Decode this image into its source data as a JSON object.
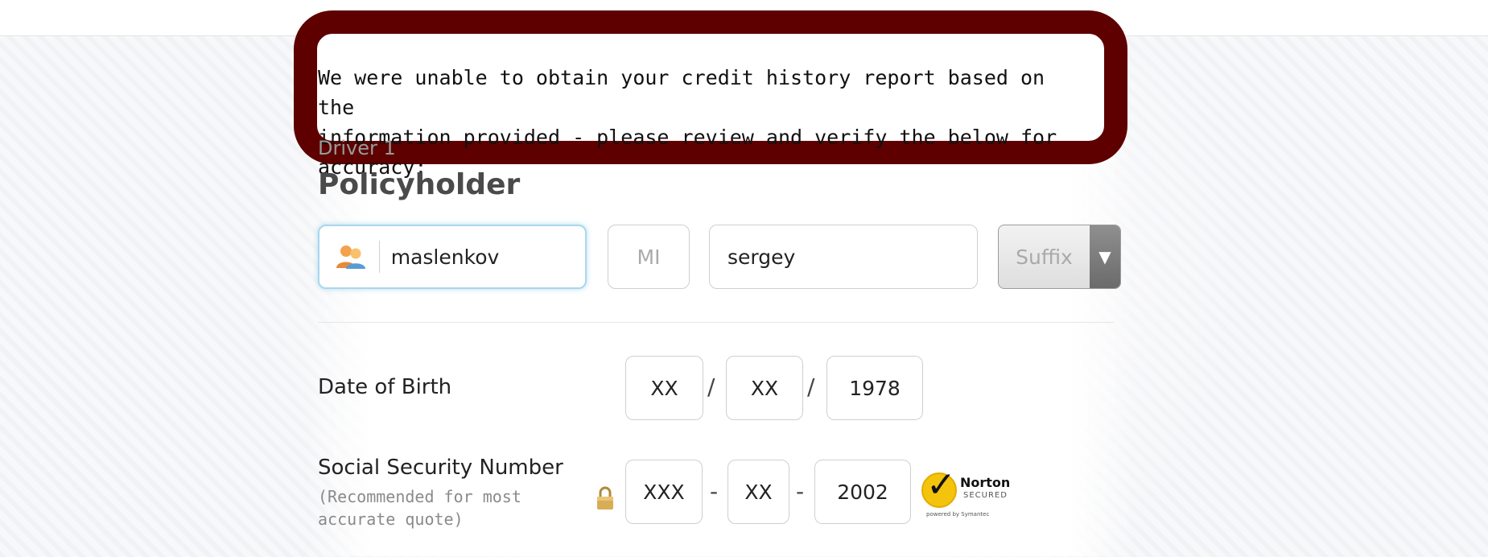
{
  "alert": {
    "message_line1": "We were unable to obtain your credit history report based on the",
    "message_line2": "information provided - please review and verify the below for accuracy:"
  },
  "driver": {
    "label": "Driver 1",
    "section_title": "Policyholder"
  },
  "name_fields": {
    "last_name_value": "maslenkov",
    "middle_initial_placeholder": "MI",
    "first_name_value": "sergey",
    "suffix_label": "Suffix"
  },
  "date_of_birth": {
    "label": "Date of Birth",
    "month": "XX",
    "day": "XX",
    "year": "1978",
    "separator": "/"
  },
  "ssn": {
    "label": "Social Security Number",
    "note": "(Recommended for most accurate quote)",
    "part1": "XXX",
    "part2": "XX",
    "part3": "2002",
    "separator": "-"
  },
  "norton_badge": {
    "title": "Norton",
    "subtitle": "SECURED",
    "powered_by": "powered by Symantec"
  },
  "colors": {
    "highlight_border": "#5e0000",
    "focus_glow": "#a9d7ee",
    "badge_yellow": "#f4c40c"
  },
  "icons": [
    "user-icon",
    "lock-icon",
    "dropdown-arrow-icon",
    "norton-check-icon"
  ]
}
